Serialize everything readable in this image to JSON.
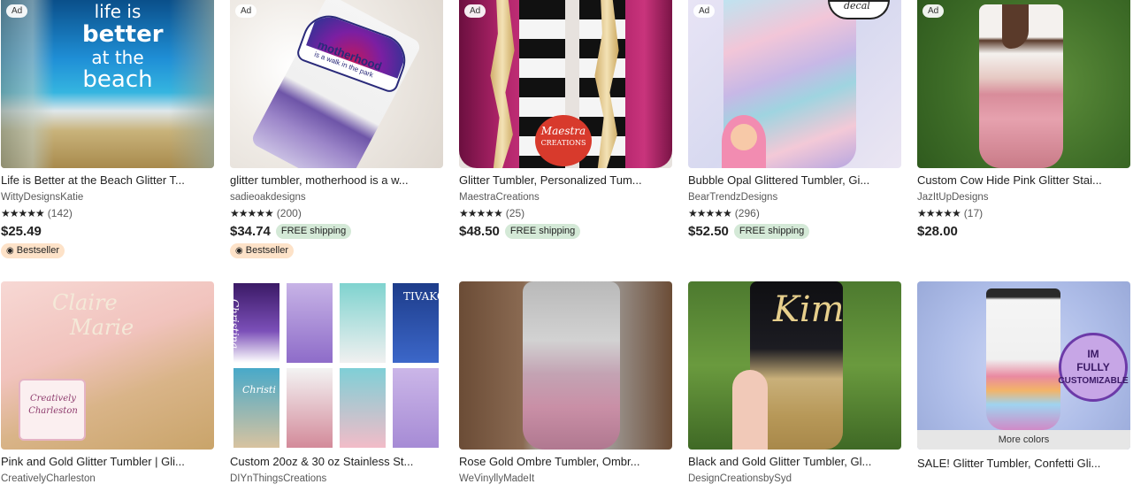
{
  "listings": [
    {
      "ad": "Ad",
      "title": "Life is Better at the Beach Glitter T...",
      "shop": "WittyDesignsKatie",
      "stars": "★★★★★",
      "reviews": "(142)",
      "price": "$25.49",
      "shipping": "",
      "badge": "Bestseller",
      "overlay": [
        "life is",
        "better",
        "at the",
        "beach"
      ]
    },
    {
      "ad": "Ad",
      "title": "glitter tumbler, motherhood is a w...",
      "shop": "sadieoakdesigns",
      "stars": "★★★★★",
      "reviews": "(200)",
      "price": "$34.74",
      "shipping": "FREE shipping",
      "badge": "Bestseller",
      "overlay": [
        "motherhood",
        "is a walk in the park"
      ]
    },
    {
      "ad": "Ad",
      "title": "Glitter Tumbler, Personalized Tum...",
      "shop": "MaestraCreations",
      "stars": "★★★★★",
      "reviews": "(25)",
      "price": "$48.50",
      "shipping": "FREE shipping",
      "badge": "",
      "overlay": [
        "Maestra",
        "CREATIONS"
      ]
    },
    {
      "ad": "Ad",
      "title": "Bubble Opal Glittered Tumbler, Gi...",
      "shop": "BearTrendzDesigns",
      "stars": "★★★★★",
      "reviews": "(296)",
      "price": "$52.50",
      "shipping": "FREE shipping",
      "badge": "",
      "overlay": [
        "decal"
      ]
    },
    {
      "ad": "Ad",
      "title": "Custom Cow Hide Pink Glitter Stai...",
      "shop": "JazItUpDesigns",
      "stars": "★★★★★",
      "reviews": "(17)",
      "price": "$28.00",
      "shipping": "",
      "badge": "",
      "overlay": []
    },
    {
      "title": "Pink and Gold Glitter Tumbler | Gli...",
      "shop": "CreativelyCharleston",
      "overlay": [
        "Claire",
        "Marie",
        "Creatively",
        "Charleston"
      ]
    },
    {
      "title": "Custom 20oz & 30 oz Stainless St...",
      "shop": "DIYnThingsCreations",
      "overlay": [
        "Christina",
        "TIVAKO",
        "Christi"
      ]
    },
    {
      "title": "Rose Gold Ombre Tumbler, Ombr...",
      "shop": "WeVinyllyMadeIt",
      "overlay": []
    },
    {
      "title": "Black and Gold Glitter Tumbler, Gl...",
      "shop": "DesignCreationsbySyd",
      "overlay": [
        "Kim"
      ]
    },
    {
      "title": "SALE! Glitter Tumbler, Confetti Gli...",
      "shop": "",
      "more_colors": "More colors",
      "overlay": [
        "IM",
        "FULLY",
        "CUSTOMIZABLE"
      ]
    }
  ],
  "icons": {
    "star": "star-icon",
    "bestseller": "ribbon-icon"
  }
}
